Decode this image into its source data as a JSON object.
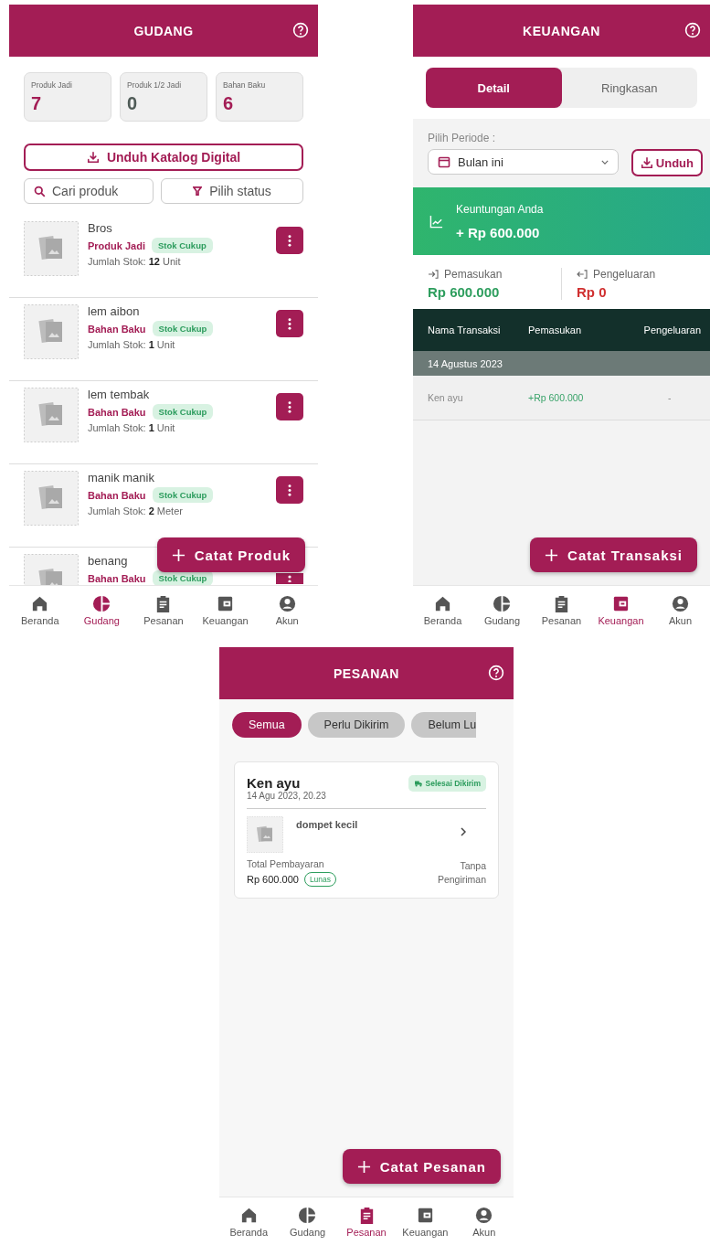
{
  "screens": [
    {
      "kind": "gudang",
      "title": "GUDANG",
      "stats": [
        {
          "label": "Produk Jadi",
          "value": "7",
          "color": "#a31d55"
        },
        {
          "label": "Produk 1/2 Jadi",
          "value": "0",
          "color": "#4f5b57"
        },
        {
          "label": "Bahan Baku",
          "value": "6",
          "color": "#a31d55"
        }
      ],
      "catalog_button": "Unduh Katalog Digital",
      "search": {
        "placeholder": "Cari produk"
      },
      "status_filter": "Pilih status",
      "products": [
        {
          "name": "Bros",
          "category": "Produk Jadi",
          "status": "Stok Cukup",
          "stock_label": "Jumlah Stok:",
          "stock_qty": "12",
          "stock_unit": "Unit"
        },
        {
          "name": "lem aibon",
          "category": "Bahan Baku",
          "status": "Stok Cukup",
          "stock_label": "Jumlah Stok:",
          "stock_qty": "1",
          "stock_unit": "Unit"
        },
        {
          "name": "lem tembak",
          "category": "Bahan Baku",
          "status": "Stok Cukup",
          "stock_label": "Jumlah Stok:",
          "stock_qty": "1",
          "stock_unit": "Unit"
        },
        {
          "name": "manik manik",
          "category": "Bahan Baku",
          "status": "Stok Cukup",
          "stock_label": "Jumlah Stok:",
          "stock_qty": "2",
          "stock_unit": "Meter"
        },
        {
          "name": "benang",
          "category": "Bahan Baku",
          "status": "Stok Cukup"
        }
      ],
      "fab": "Catat Produk",
      "nav": [
        {
          "label": "Beranda",
          "selected": false
        },
        {
          "label": "Gudang",
          "selected": true
        },
        {
          "label": "Pesanan",
          "selected": false
        },
        {
          "label": "Keuangan",
          "selected": false
        },
        {
          "label": "Akun",
          "selected": false
        }
      ]
    },
    {
      "kind": "keuangan",
      "title": "KEUANGAN",
      "tabs": [
        {
          "label": "Detail",
          "selected": true
        },
        {
          "label": "Ringkasan",
          "selected": false
        }
      ],
      "period_label": "Pilih Periode :",
      "period": {
        "value": "Bulan ini"
      },
      "download_button": "Unduh",
      "profit": {
        "label": "Keuntungan Anda",
        "amount": "+ Rp 600.000"
      },
      "income": {
        "label": "Pemasukan",
        "amount": "Rp 600.000"
      },
      "expense": {
        "label": "Pengeluaran",
        "amount": "Rp 0"
      },
      "table": {
        "columns": [
          "Nama Transaksi",
          "Pemasukan",
          "Pengeluaran"
        ],
        "groups": [
          {
            "date": "14 Agustus 2023",
            "rows": [
              [
                "Ken ayu",
                "+Rp 600.000",
                "-"
              ]
            ]
          }
        ]
      },
      "fab": "Catat Transaksi",
      "nav": [
        {
          "label": "Beranda",
          "selected": false
        },
        {
          "label": "Gudang",
          "selected": false
        },
        {
          "label": "Pesanan",
          "selected": false
        },
        {
          "label": "Keuangan",
          "selected": true
        },
        {
          "label": "Akun",
          "selected": false
        }
      ]
    },
    {
      "kind": "pesanan",
      "title": "PESANAN",
      "filters": [
        {
          "label": "Semua",
          "selected": true
        },
        {
          "label": "Perlu Dikirim",
          "selected": false
        },
        {
          "label": "Belum Lu",
          "selected": false
        }
      ],
      "orders": [
        {
          "customer": "Ken ayu",
          "date": "14 Agu 2023, 20.23",
          "status": "Selesai Dikirim",
          "item": "dompet kecil",
          "total_label": "Total Pembayaran",
          "total": "Rp 600.000",
          "payment": "Lunas",
          "shipping": "Tanpa Pengiriman"
        }
      ],
      "fab": "Catat Pesanan",
      "nav": [
        {
          "label": "Beranda",
          "selected": false
        },
        {
          "label": "Gudang",
          "selected": false
        },
        {
          "label": "Pesanan",
          "selected": true
        },
        {
          "label": "Keuangan",
          "selected": false
        },
        {
          "label": "Akun",
          "selected": false
        }
      ]
    }
  ]
}
